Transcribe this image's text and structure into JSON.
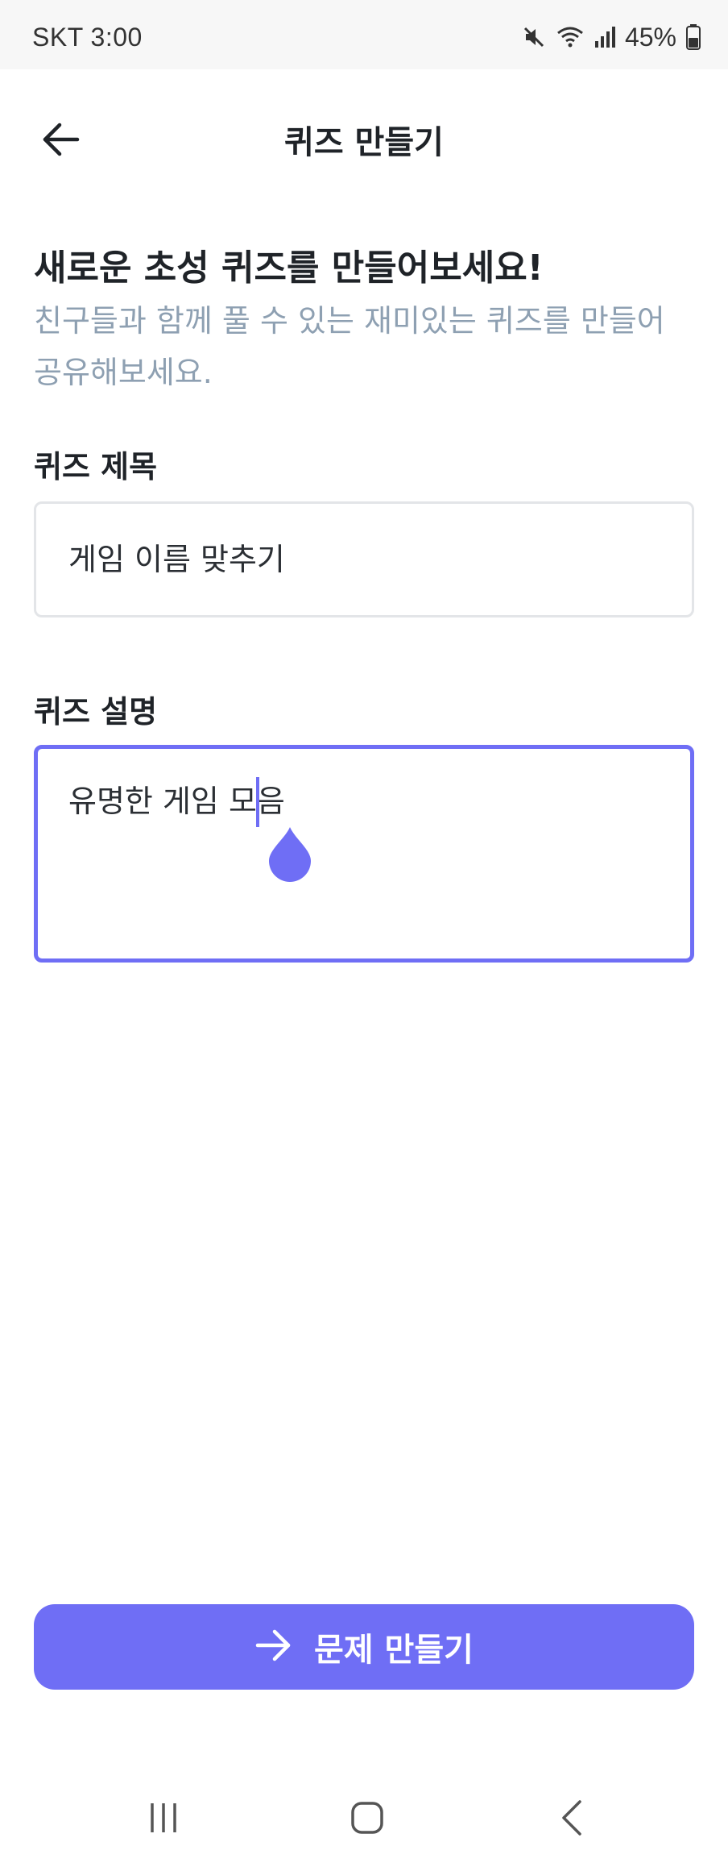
{
  "status_bar": {
    "carrier_time": "SKT 3:00",
    "battery_percent": "45%",
    "icons": [
      "mute-icon",
      "wifi-icon",
      "signal-icon",
      "battery-icon"
    ]
  },
  "header": {
    "title": "퀴즈 만들기",
    "back_icon": "arrow-left-icon"
  },
  "intro": {
    "heading": "새로운 초성 퀴즈를 만들어보세요!",
    "subtext": "친구들과 함께 풀 수 있는 재미있는 퀴즈를 만들어 공유해보세요."
  },
  "form": {
    "title_label": "퀴즈 제목",
    "title_value": "게임 이름 맞추기",
    "description_label": "퀴즈 설명",
    "description_value": "유명한 게임 모음"
  },
  "actions": {
    "create_label": "문제 만들기",
    "create_icon": "arrow-right-icon"
  },
  "nav_bar": {
    "buttons": [
      "recents-icon",
      "home-icon",
      "back-icon"
    ]
  },
  "colors": {
    "accent": "#6f6ef5",
    "subtext": "#8ea0b2",
    "text": "#1f2328",
    "input_border": "#e3e5e8"
  }
}
